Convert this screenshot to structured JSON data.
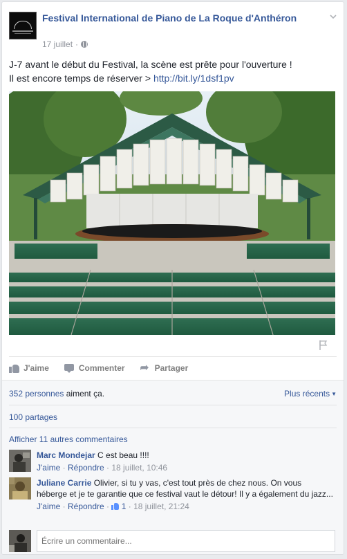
{
  "post": {
    "page_name": "Festival International de Piano de La Roque d'Anthéron",
    "date": "17 juillet",
    "separator": "·",
    "text_line1": "J-7 avant le début du Festival, la scène est prête pour l'ouverture !",
    "text_line2_prefix": "Il est encore temps de réserver > ",
    "link": "http://bit.ly/1dsf1pv",
    "icons": {
      "options": "chevron-down-icon",
      "audience": "globe-icon",
      "report": "flag-icon"
    }
  },
  "actions": {
    "like": "J'aime",
    "comment": "Commenter",
    "share": "Partager"
  },
  "stats": {
    "likes_count": "352 personnes",
    "likes_suffix": " aiment ça.",
    "sort_label": "Plus récents",
    "shares": "100 partages",
    "more_comments": "Afficher 11 autres commentaires"
  },
  "comments": [
    {
      "author": "Marc Mondejar",
      "text": "C est beau !!!!",
      "like": "J'aime",
      "reply": "Répondre",
      "time": "18 juillet, 10:46"
    },
    {
      "author": "Juliane Carrie",
      "text": "Olivier, si tu y vas, c'est tout près de chez nous. On vous héberge et je te garantie que ce festival vaut le détour! Il y a également du jazz...",
      "like": "J'aime",
      "reply": "Répondre",
      "likes": "1",
      "time": "18 juillet, 21:24"
    }
  ],
  "composer": {
    "placeholder": "Écrire un commentaire..."
  },
  "colors": {
    "link": "#365899",
    "muted": "#90949c",
    "panel": "#f6f7f9"
  }
}
